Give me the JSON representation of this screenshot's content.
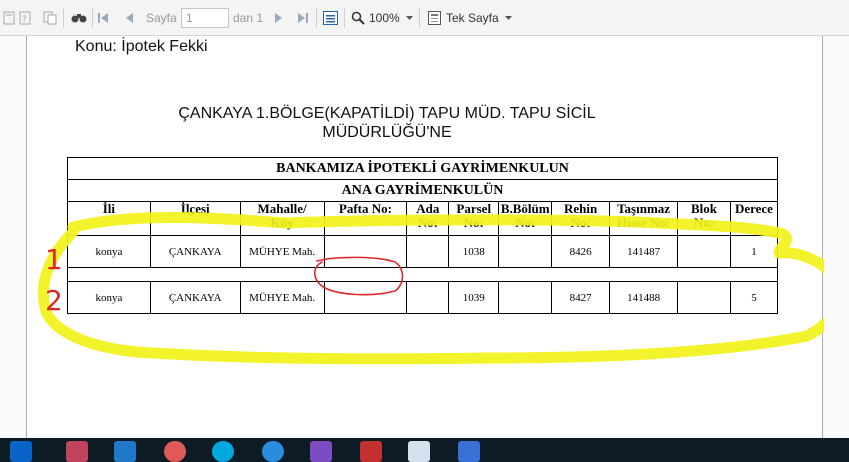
{
  "toolbar": {
    "page_label": "Sayfa",
    "page_value": "1",
    "page_of": "dan 1",
    "zoom": "100%",
    "layout": "Tek Sayfa"
  },
  "document": {
    "subject": "Konu: İpotek Fekki",
    "office_line1": "ÇANKAYA 1.BÖLGE(KAPATİLDİ) TAPU MÜD. TAPU SİCİL",
    "office_line2": "MÜDÜRLÜĞÜ'NE",
    "table_title": "BANKAMIZA İPOTEKLİ GAYRİMENKULUN",
    "table_subtitle": "ANA GAYRİMENKULÜN",
    "columns": [
      [
        "İli"
      ],
      [
        "İlçesi"
      ],
      [
        "Mahalle/",
        "Köy"
      ],
      [
        "Pafta No:"
      ],
      [
        "Ada",
        "No:"
      ],
      [
        "Parsel",
        "No:"
      ],
      [
        "B.Bölüm",
        "No:"
      ],
      [
        "Rehin",
        "No:"
      ],
      [
        "Taşınmaz",
        "Hisse No:"
      ],
      [
        "Blok",
        "No:"
      ],
      [
        "Derece"
      ]
    ],
    "rows": [
      [
        "konya",
        "ÇANKAYA",
        "MÜHYE Mah.",
        "",
        "",
        "1038",
        "",
        "8426",
        "141487",
        "",
        "1"
      ],
      [
        "konya",
        "ÇANKAYA",
        "MÜHYE Mah.",
        "",
        "",
        "1039",
        "",
        "8427",
        "141488",
        "",
        "5"
      ]
    ]
  },
  "annotations": {
    "row_labels": [
      "1",
      "2"
    ],
    "highlight_color": "#f2f21a",
    "mark_color": "#e0262a"
  },
  "taskbar": {
    "apps": [
      "outlook-icon",
      "database-icon",
      "visual-studio-code-icon",
      "disk-icon",
      "skype-icon",
      "internet-explorer-icon",
      "visual-studio-icon",
      "filezilla-icon",
      "notepad-icon",
      "sublime-icon"
    ]
  }
}
